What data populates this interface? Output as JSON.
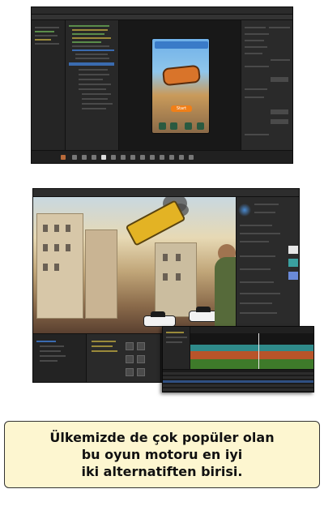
{
  "screenshot_top": {
    "window_title": "",
    "game_preview": {
      "start_button_label": "Start"
    }
  },
  "screenshot_bottom": {
    "profiler_visible": true
  },
  "caption": {
    "line1": "Ülkemizde de çok popüler olan",
    "line2": "bu oyun motoru en iyi",
    "line3": "iki alternatiften birisi."
  },
  "colors": {
    "caption_background": "#fdf6d0",
    "caption_border": "#333333",
    "editor_dark": "#222222",
    "accent_blue": "#3a6bb0",
    "start_button": "#f07f18"
  }
}
